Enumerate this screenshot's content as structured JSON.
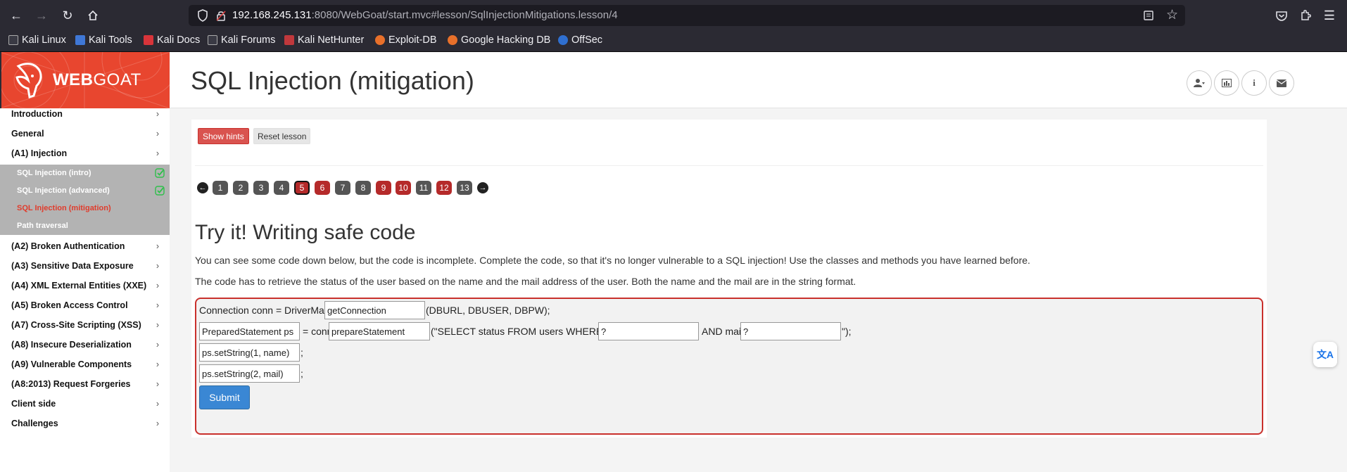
{
  "browser": {
    "url_host": "192.168.245.131",
    "url_rest": ":8080/WebGoat/start.mvc#lesson/SqlInjectionMitigations.lesson/4",
    "bookmarks": [
      "Kali Linux",
      "Kali Tools",
      "Kali Docs",
      "Kali Forums",
      "Kali NetHunter",
      "Exploit-DB",
      "Google Hacking DB",
      "OffSec"
    ]
  },
  "logo": {
    "web": "WEB",
    "goat": "GOAT"
  },
  "header": {
    "title": "SQL Injection (mitigation)"
  },
  "sidebar": {
    "categories": [
      "Introduction",
      "General",
      "(A1) Injection",
      "(A2) Broken Authentication",
      "(A3) Sensitive Data Exposure",
      "(A4) XML External Entities (XXE)",
      "(A5) Broken Access Control",
      "(A7) Cross-Site Scripting (XSS)",
      "(A8) Insecure Deserialization",
      "(A9) Vulnerable Components",
      "(A8:2013) Request Forgeries",
      "Client side",
      "Challenges"
    ],
    "subitems": [
      "SQL Injection (intro)",
      "SQL Injection (advanced)",
      "SQL Injection (mitigation)",
      "Path traversal"
    ]
  },
  "lesson": {
    "show_hints": "Show hints",
    "reset_lesson": "Reset lesson",
    "pages": [
      "1",
      "2",
      "3",
      "4",
      "5",
      "6",
      "7",
      "8",
      "9",
      "10",
      "11",
      "12",
      "13"
    ],
    "current_page": "5",
    "section_title": "Try it! Writing safe code",
    "para1": "You can see some code down below, but the code is incomplete. Complete the code, so that it's no longer vulnerable to a SQL injection! Use the classes and methods you have learned before.",
    "para2": "The code has to retrieve the status of the user based on the name and the mail address of the user. Both the name and the mail are in the string format."
  },
  "code": {
    "line1_prefix": "Connection conn = DriverManager.",
    "field1": "getConnection",
    "line1_suffix": "(DBURL, DBUSER, DBPW);",
    "field2": "PreparedStatement ps",
    "line2_mid": "= conn.",
    "field3": "prepareStatement",
    "line2_query": "(\"SELECT status FROM users WHERE name=",
    "field4": "?",
    "line2_and": "AND mail=",
    "field5": "?",
    "line2_end": "\");",
    "field6": "ps.setString(1, name)",
    "field7": "ps.setString(2, mail)",
    "semicolon": ";",
    "submit": "Submit"
  },
  "colors": {
    "accent": "#e8462f",
    "danger": "#d9534f",
    "primary": "#3a87d4"
  }
}
